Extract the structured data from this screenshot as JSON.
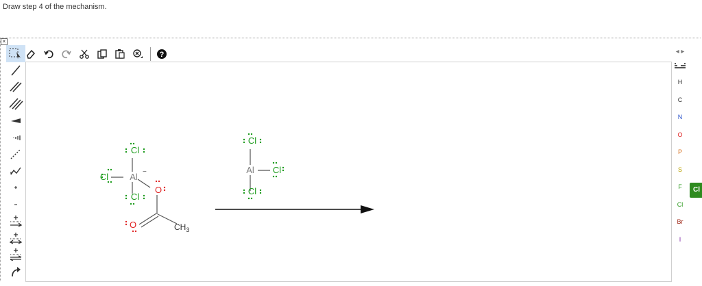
{
  "prompt": "Draw step 4 of the mechanism.",
  "toolbar": {
    "close_glyph": "×",
    "help_glyph": "?"
  },
  "elements": [
    {
      "symbol": "H",
      "color": "#333333"
    },
    {
      "symbol": "C",
      "color": "#333333"
    },
    {
      "symbol": "N",
      "color": "#2a52c9"
    },
    {
      "symbol": "O",
      "color": "#e02424"
    },
    {
      "symbol": "P",
      "color": "#d9782a"
    },
    {
      "symbol": "S",
      "color": "#b8a100"
    },
    {
      "symbol": "F",
      "color": "#2e9a1f"
    },
    {
      "symbol": "Cl",
      "color": "#2e9a1f"
    },
    {
      "symbol": "Br",
      "color": "#a02a1a"
    },
    {
      "symbol": "I",
      "color": "#7b1fa2"
    }
  ],
  "active_element_tab": "Cl",
  "nav_arrows": "◂ ▸",
  "colors": {
    "chlorine": "#1a9a1a",
    "oxygen": "#e02424",
    "aluminum": "#808080",
    "bond": "#555555",
    "arrow": "#111111"
  },
  "canvas": {
    "molecule1": {
      "cl_top": "Cl",
      "cl_left": "Cl",
      "cl_bottom": "Cl",
      "al": "Al",
      "al_charge": "−",
      "o_single": "O",
      "o_double": "O",
      "methyl": "CH",
      "methyl_sub": "3"
    },
    "molecule2": {
      "cl_top": "Cl",
      "cl_right": "Cl",
      "cl_bottom": "Cl",
      "al": "Al"
    }
  }
}
